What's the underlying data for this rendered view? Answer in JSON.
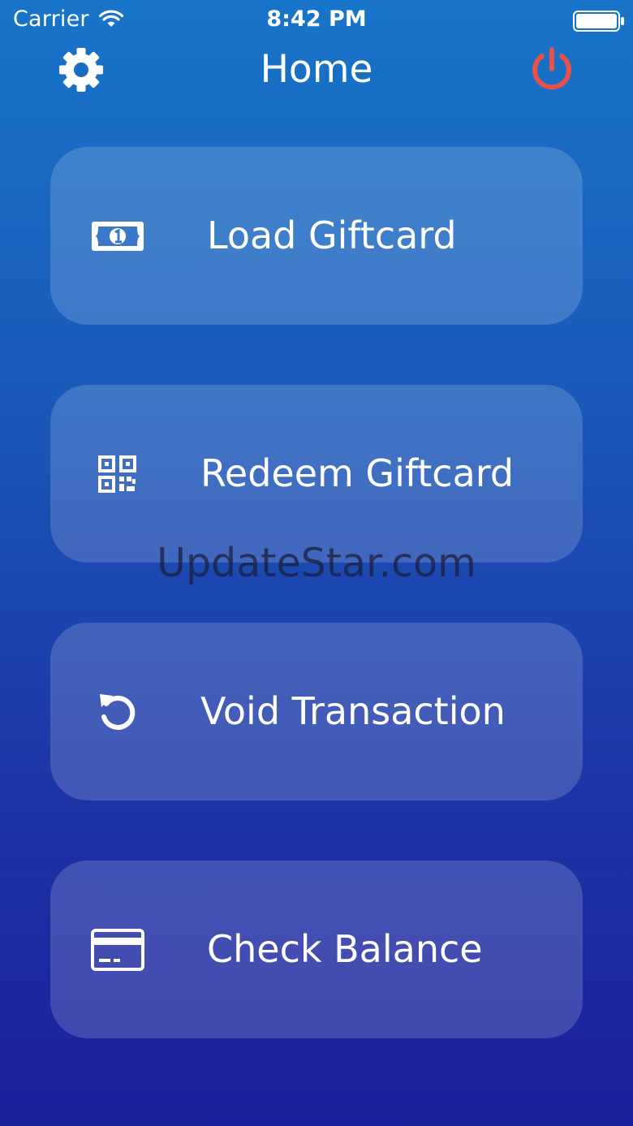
{
  "status_bar": {
    "carrier": "Carrier",
    "time": "8:42 PM",
    "wifi_icon": "wifi-icon",
    "battery_icon": "battery-full-icon"
  },
  "nav": {
    "title": "Home",
    "settings_icon": "gear-icon",
    "logout_icon": "power-icon",
    "logout_color": "#e8504a"
  },
  "menu": {
    "items": [
      {
        "label": "Load Giftcard",
        "icon": "banknote-icon"
      },
      {
        "label": "Redeem Giftcard",
        "icon": "qr-code-icon"
      },
      {
        "label": "Void Transaction",
        "icon": "undo-icon"
      },
      {
        "label": "Check Balance",
        "icon": "credit-card-icon"
      }
    ]
  },
  "watermark": "UpdateStar.com",
  "colors": {
    "gradient_top": "#1875c9",
    "gradient_bottom": "#1e1f9c",
    "button_fill": "rgba(255,255,255,0.17)"
  }
}
